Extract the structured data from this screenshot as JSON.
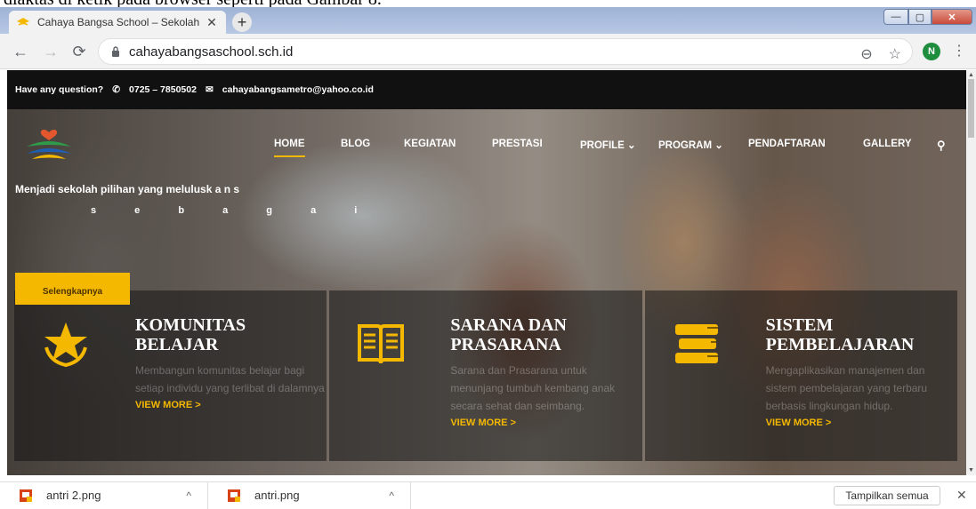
{
  "doc_fragment": "diaktas di ketik pada browser seperti pada Gambar 8.",
  "browser": {
    "tab_title": "Cahaya Bangsa School – Sekolah",
    "tab_close": "✕",
    "new_tab": "+",
    "url": "cahayabangsaschool.sch.id",
    "avatar_letter": "N"
  },
  "topbar": {
    "question": "Have any question?",
    "phone": "0725 – 7850502",
    "email": "cahayabangsametro@yahoo.co.id"
  },
  "nav": {
    "items": [
      "HOME",
      "BLOG",
      "KEGIATAN",
      "PRESTASI",
      "PROFILE",
      "PROGRAM",
      "PENDAFTARAN",
      "GALLERY"
    ],
    "active": "HOME"
  },
  "hero": {
    "tagline": "Menjadi sekolah pilihan yang melulusk a n  s",
    "tagline_cont": "s e b a g a i",
    "button": "Selengkapnya"
  },
  "cards": [
    {
      "icon": "star-laurel-icon",
      "title_1": "KOMUNITAS",
      "title_2": "BELAJAR",
      "desc": "Membangun komunitas belajar bagi setiap individu yang terlibat di dalamnya",
      "link": "VIEW MORE >"
    },
    {
      "icon": "open-book-icon",
      "title_1": "SARANA DAN",
      "title_2": "PRASARANA",
      "desc": "Sarana dan Prasarana untuk menunjang tumbuh kembang anak secara sehat dan seimbang.",
      "link": "VIEW MORE >"
    },
    {
      "icon": "book-stack-icon",
      "title_1": "SISTEM",
      "title_2": "PEMBELAJARAN",
      "desc": "Mengaplikasikan manajemen dan sistem pembelajaran yang terbaru berbasis lingkungan hidup.",
      "link": "VIEW MORE >"
    }
  ],
  "downloads": {
    "files": [
      "antri 2.png",
      "antri.png"
    ],
    "show_all": "Tampilkan semua"
  },
  "colors": {
    "accent": "#f5b800",
    "topbar_bg": "#111111"
  }
}
